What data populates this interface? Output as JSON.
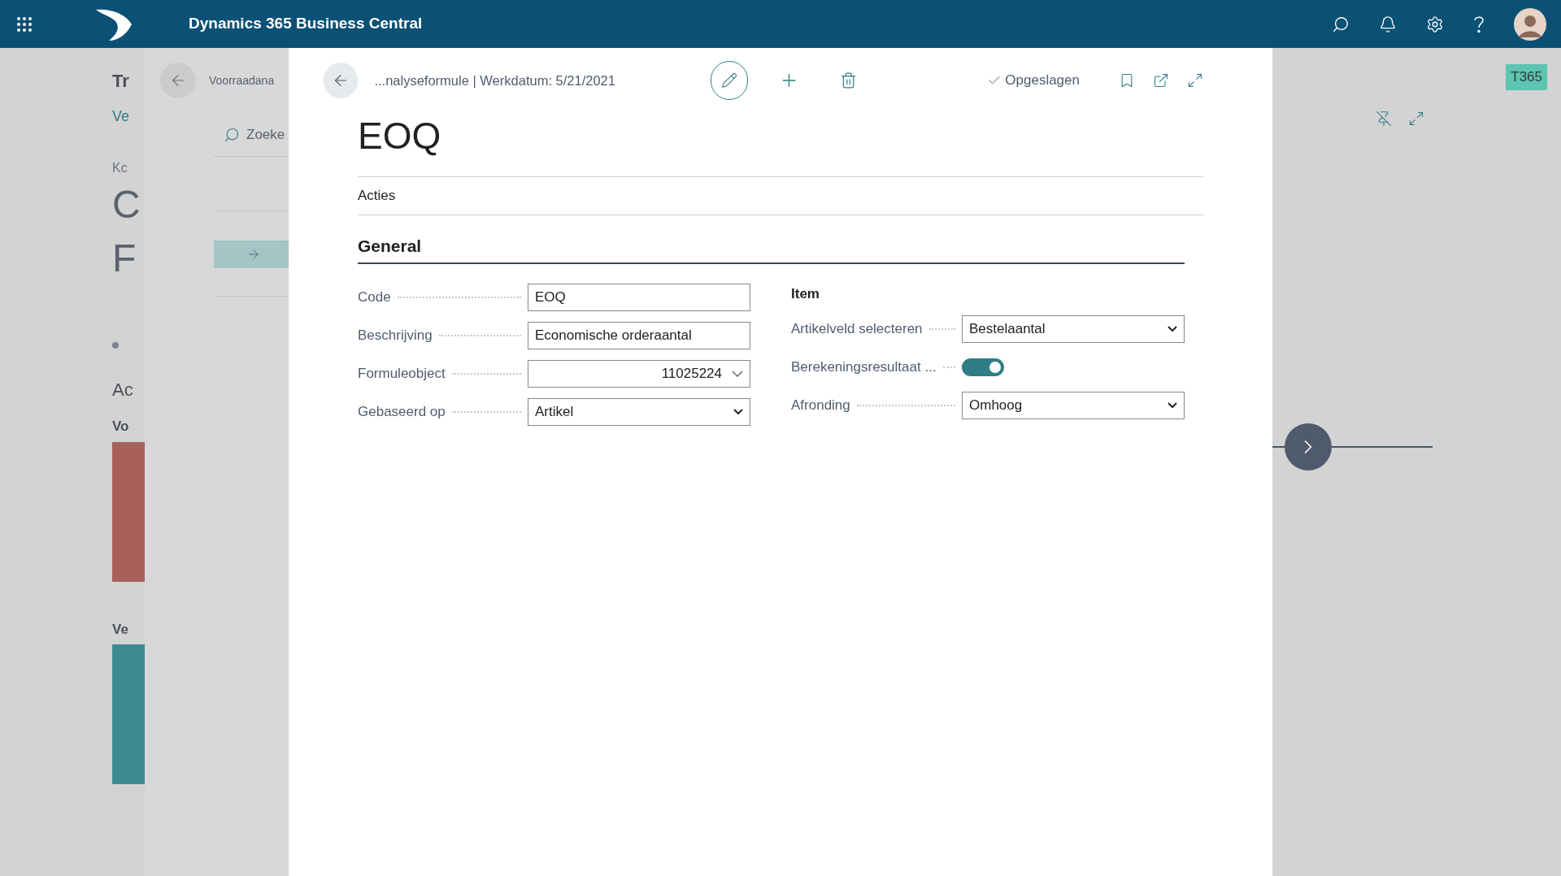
{
  "app_bar": {
    "title": "Dynamics 365 Business Central"
  },
  "background_page": {
    "title": "Tr",
    "link": "Ve",
    "caption": "Kc",
    "headline_lines": [
      "C",
      "F"
    ],
    "section": "Ac",
    "group_1": "Vo",
    "group_2": "Ve"
  },
  "list_page": {
    "breadcrumb": "Voorraadana",
    "search": "Zoeke"
  },
  "card": {
    "breadcrumb": "...nalyseformule | Werkdatum: 5/21/2021",
    "status": "Opgeslagen",
    "title": "EOQ",
    "actions_tab": "Acties",
    "section": "General",
    "left_fields": [
      {
        "label": "Code",
        "value": "EOQ",
        "kind": "text"
      },
      {
        "label": "Beschrijving",
        "value": "Economische orderaantal",
        "kind": "text"
      },
      {
        "label": "Formuleobject",
        "value": "11025224",
        "kind": "lookup"
      },
      {
        "label": "Gebaseerd op",
        "value": "Artikel",
        "kind": "select"
      }
    ],
    "group_title": "Item",
    "right_fields": [
      {
        "label": "Artikelveld selecteren",
        "value": "Bestelaantal",
        "kind": "select"
      },
      {
        "label": "Berekeningsresultaat ...",
        "kind": "toggle",
        "on": true
      },
      {
        "label": "Afronding",
        "value": "Omhoog",
        "kind": "select"
      }
    ]
  },
  "badge": "T365"
}
